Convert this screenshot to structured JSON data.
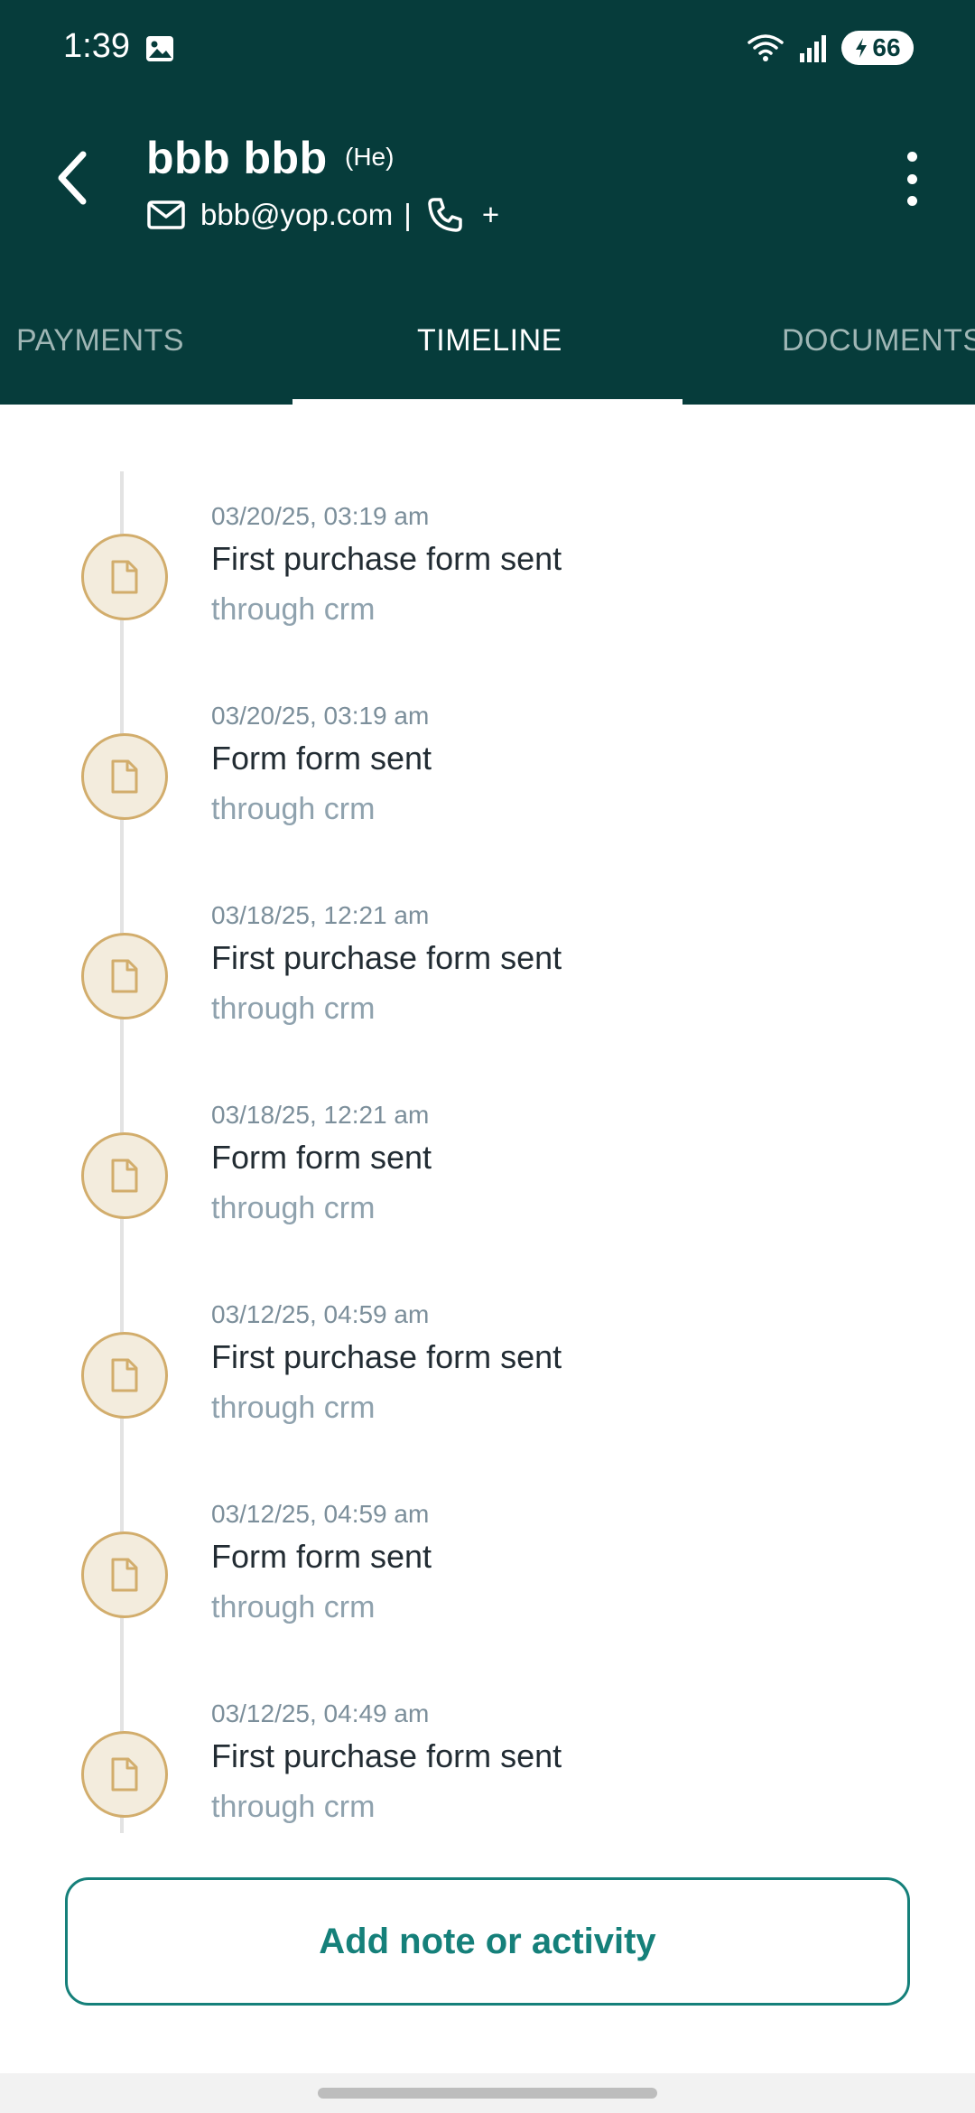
{
  "status_bar": {
    "time": "1:39",
    "battery": "66",
    "icons": [
      "gallery-icon",
      "wifi-icon",
      "signal-icon",
      "battery-charging-icon"
    ]
  },
  "contact": {
    "name": "bbb bbb",
    "pronoun": "(He)",
    "email": "bbb@yop.com",
    "separator": "|",
    "phone": "+"
  },
  "tabs": [
    {
      "label": "PAYMENTS",
      "active": false
    },
    {
      "label": "TIMELINE",
      "active": true
    },
    {
      "label": "DOCUMENTS",
      "active": false
    }
  ],
  "timeline": [
    {
      "date": "03/20/25, 03:19 am",
      "title": "First purchase form sent",
      "sub": "through crm",
      "icon": "document-icon"
    },
    {
      "date": "03/20/25, 03:19 am",
      "title": "Form form sent",
      "sub": "through crm",
      "icon": "document-icon"
    },
    {
      "date": "03/18/25, 12:21 am",
      "title": "First purchase form sent",
      "sub": "through crm",
      "icon": "document-icon"
    },
    {
      "date": "03/18/25, 12:21 am",
      "title": "Form form sent",
      "sub": "through crm",
      "icon": "document-icon"
    },
    {
      "date": "03/12/25, 04:59 am",
      "title": "First purchase form sent",
      "sub": "through crm",
      "icon": "document-icon"
    },
    {
      "date": "03/12/25, 04:59 am",
      "title": "Form form sent",
      "sub": "through crm",
      "icon": "document-icon"
    },
    {
      "date": "03/12/25, 04:49 am",
      "title": "First purchase form sent",
      "sub": "through crm",
      "icon": "document-icon"
    }
  ],
  "add_button": {
    "label": "Add note or activity"
  },
  "colors": {
    "header": "#063c3b",
    "accent": "#15807a",
    "icon_border": "#d2ad6c",
    "icon_fill": "#f3ecdd"
  }
}
